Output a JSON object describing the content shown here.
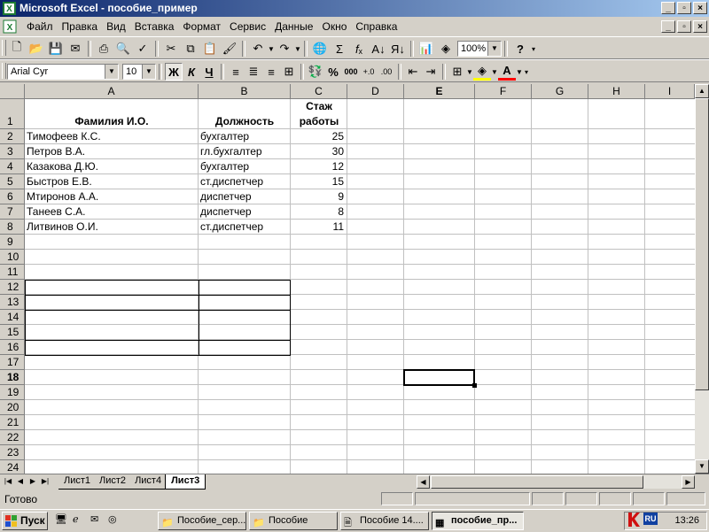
{
  "window": {
    "title": "Microsoft Excel - пособие_пример"
  },
  "menu": {
    "items": [
      "Файл",
      "Правка",
      "Вид",
      "Вставка",
      "Формат",
      "Сервис",
      "Данные",
      "Окно",
      "Справка"
    ]
  },
  "toolbar": {
    "zoom": "100%",
    "help_glyph": "?"
  },
  "format_toolbar": {
    "font": "Arial Cyr",
    "size": "10",
    "bold": "Ж",
    "italic": "К",
    "underline": "Ч",
    "percent": "%",
    "thousands": "000"
  },
  "columns": [
    "A",
    "B",
    "C",
    "D",
    "E",
    "F",
    "G",
    "H",
    "I"
  ],
  "active_column": "E",
  "active_row": "18",
  "rows": [
    "1",
    "2",
    "3",
    "4",
    "5",
    "6",
    "7",
    "8",
    "9",
    "10",
    "11",
    "12",
    "13",
    "14",
    "15",
    "16",
    "17",
    "18",
    "19",
    "20",
    "21",
    "22",
    "23",
    "24"
  ],
  "sheet": {
    "header": {
      "name": "Фамилия И.О.",
      "position": "Должность",
      "exp_line1": "Стаж",
      "exp_line2": "работы"
    },
    "data": [
      {
        "name": "Тимофеев К.С.",
        "position": "бухгалтер",
        "exp": "25"
      },
      {
        "name": "Петров В.А.",
        "position": "гл.бухгалтер",
        "exp": "30"
      },
      {
        "name": "Казакова Д.Ю.",
        "position": "бухгалтер",
        "exp": "12"
      },
      {
        "name": "Быстров Е.В.",
        "position": "ст.диспетчер",
        "exp": "15"
      },
      {
        "name": "Мтиронов А.А.",
        "position": "диспетчер",
        "exp": "9"
      },
      {
        "name": "Танеев С.А.",
        "position": "диспетчер",
        "exp": "8"
      },
      {
        "name": "Литвинов  О.И.",
        "position": "ст.диспетчер",
        "exp": "11"
      }
    ]
  },
  "tabs": {
    "items": [
      "Лист1",
      "Лист2",
      "Лист4",
      "Лист3"
    ],
    "active": "Лист3"
  },
  "status": {
    "text": "Готово"
  },
  "taskbar": {
    "start": "Пуск",
    "items": [
      "Пособие_сер...",
      "Пособие",
      "Пособие 14....",
      "пособие_пр..."
    ],
    "lang": "RU",
    "clock": "13:26"
  }
}
